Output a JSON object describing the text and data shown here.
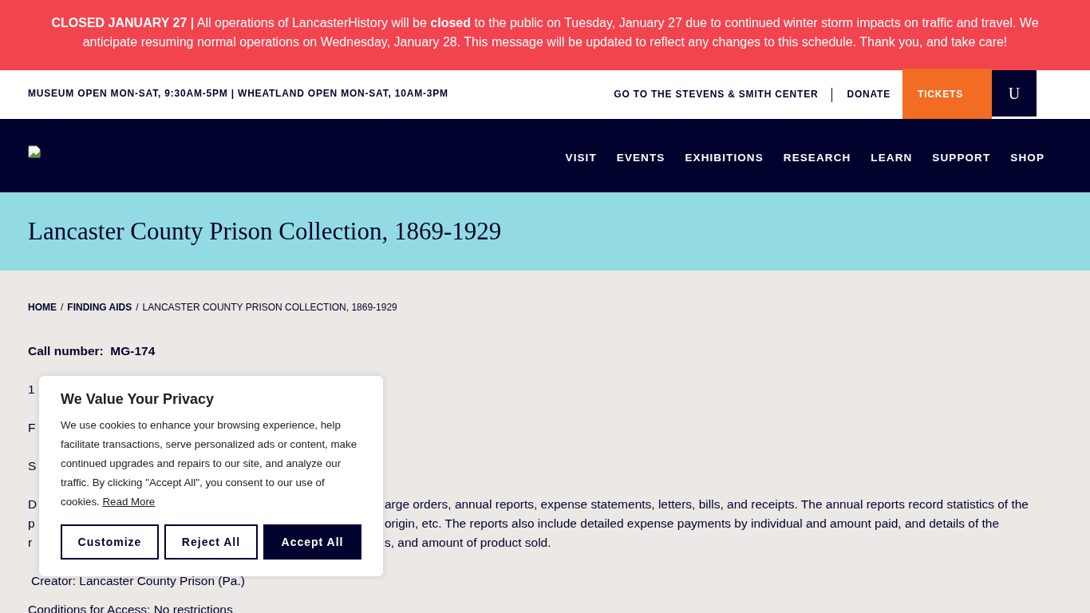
{
  "alert": {
    "text": "**CLOSED JANUARY 27 |** All operations of LancasterHistory will be **closed** to the public on Tuesday, January 27 due to continued winter storm impacts on traffic and travel. We anticipate resuming normal operations on Wednesday, January 28. This message will be updated to reflect any changes to this schedule. Thank you, and take care!"
  },
  "utility_bar": {
    "hours": "MUSEUM OPEN MON-SAT, 9:30AM-5PM | WHEATLAND OPEN MON-SAT, 10AM-3PM",
    "links": [
      "GO TO THE STEVENS & SMITH CENTER",
      "DONATE"
    ],
    "tickets": "TICKETS",
    "account": "U"
  },
  "nav": {
    "items": [
      "VISIT",
      "EVENTS",
      "EXHIBITIONS",
      "RESEARCH",
      "LEARN",
      "SUPPORT",
      "SHOP"
    ]
  },
  "hero": {
    "title": "Lancaster County Prison Collection, 1869-1929"
  },
  "breadcrumb": [
    {
      "label": "HOME",
      "kind": "link"
    },
    {
      "label": "/",
      "kind": "separator"
    },
    {
      "label": "FINDING AIDS",
      "kind": "link"
    },
    {
      "label": "/",
      "kind": "separator"
    },
    {
      "label": "LANCASTER COUNTY PRISON COLLECTION, 1869-1929",
      "kind": "current"
    }
  ],
  "content": {
    "call_number": "Call number:  MG-174",
    "fragments": [
      "1",
      "F",
      "S"
    ],
    "description_lines": [
      {
        "start": "D",
        "end": "arge orders, annual reports, expense statements, letters, bills, and receipts. The annual reports record statistics of the"
      },
      {
        "start": "p",
        "end": "origin, etc. The reports also include detailed expense payments by individual and amount paid, and details of the"
      },
      {
        "start": "r",
        "end": "s, and amount of product sold."
      }
    ],
    "creator": "Creator: Lancaster County Prison (Pa.)",
    "conditions": "Conditions for Access: No restrictions"
  },
  "cookie_dialog": {
    "title": "We Value Your Privacy",
    "text": "We use cookies to enhance your browsing experience, help facilitate transactions, serve personalized ads or content, make continued upgrades and repairs to our site, and analyze our traffic. By clicking \"Accept All\", you consent to our use of cookies.",
    "link": "Read More",
    "buttons": [
      {
        "label": "Customize",
        "kind": "outline"
      },
      {
        "label": "Reject All",
        "kind": "outline"
      },
      {
        "label": "Accept All",
        "kind": "primary"
      }
    ]
  }
}
